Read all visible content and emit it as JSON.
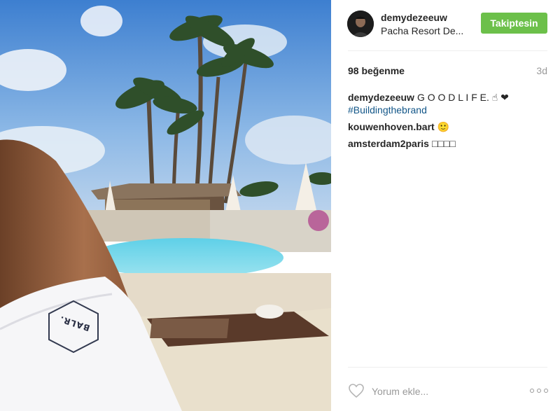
{
  "post": {
    "username": "demydezeeuw",
    "location": "Pacha Resort De...",
    "follow_label": "Takiptesin",
    "likes": "98 beğenme",
    "time_ago": "3d"
  },
  "comments": [
    {
      "user": "demydezeeuw",
      "text": "G O O D L I F E. ☝ ❤",
      "hashtag": "#Buildingthebrand"
    },
    {
      "user": "kouwenhoven.bart",
      "text": "🙂"
    },
    {
      "user": "amsterdam2paris",
      "text": "□□□□"
    }
  ],
  "composer": {
    "placeholder": "Yorum ekle..."
  },
  "photo": {
    "brand_text": "BALR."
  },
  "colors": {
    "follow_bg": "#6cc04a",
    "hashtag": "#125688",
    "sky": "#4f8fd6",
    "pool": "#6fd3e6"
  },
  "icons": {
    "like": "heart-outline-icon",
    "more": "more-options-icon"
  }
}
